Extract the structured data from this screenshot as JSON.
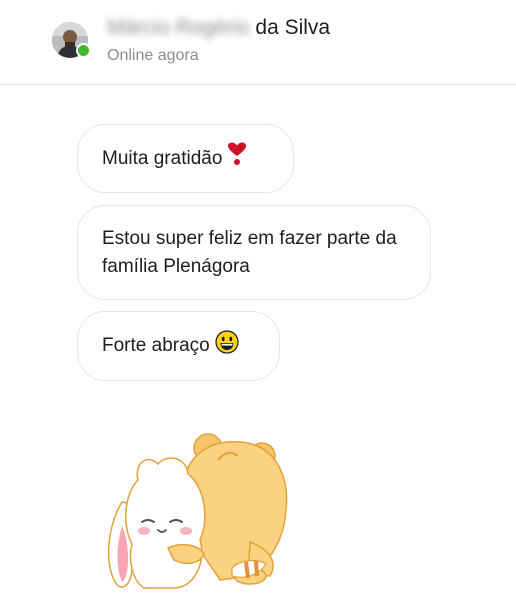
{
  "header": {
    "contact_name_hidden": "Márcio Rogério",
    "contact_surname": "da Silva",
    "status": "Online agora",
    "presence_color": "#42b72a"
  },
  "messages": [
    {
      "text": "Muita gratidão",
      "emoji": "heart-exclamation-icon"
    },
    {
      "text": "Estou super feliz em fazer parte da família Plenágora",
      "emoji": ""
    },
    {
      "text": "Forte abraço",
      "emoji": "grinning-face-icon"
    }
  ],
  "sticker": {
    "name": "bunny-bear-hug-sticker"
  }
}
